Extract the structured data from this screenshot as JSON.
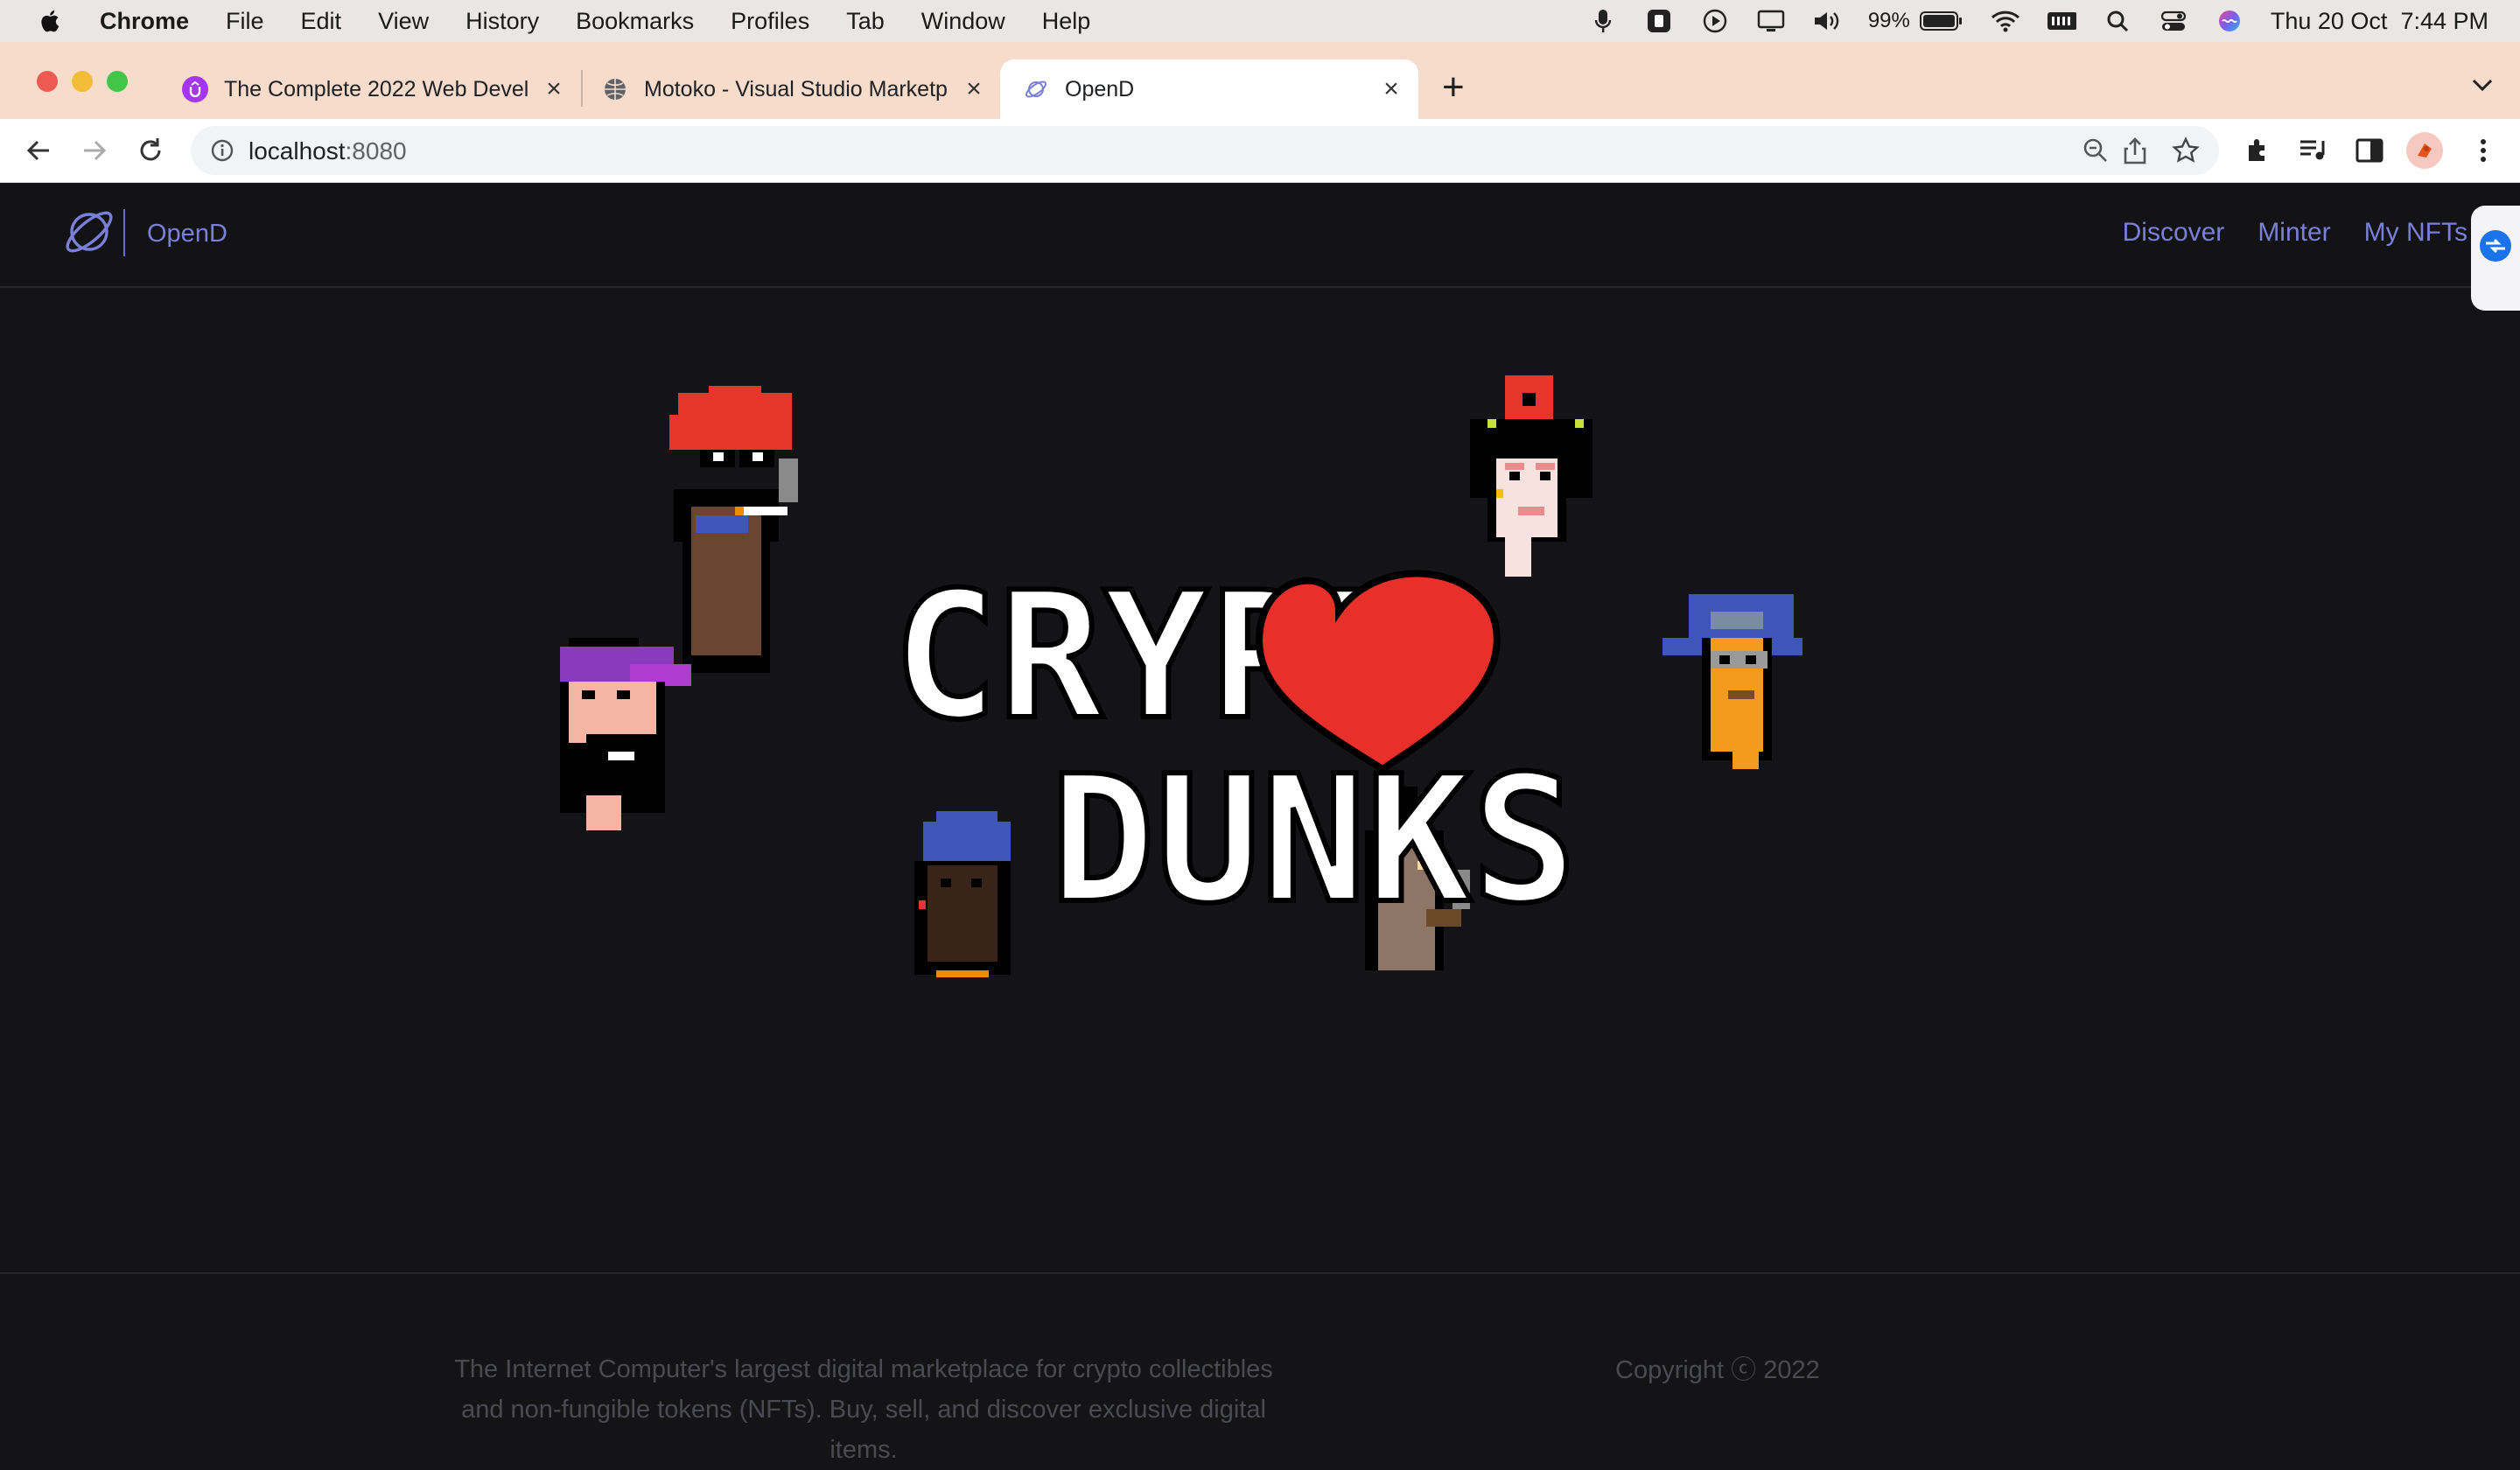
{
  "menubar": {
    "app": "Chrome",
    "items": [
      "File",
      "Edit",
      "View",
      "History",
      "Bookmarks",
      "Profiles",
      "Tab",
      "Window",
      "Help"
    ],
    "battery": "99%",
    "datetime": "Thu 20 Oct  7:44 PM"
  },
  "tabs": [
    {
      "title": "The Complete 2022 Web Devel",
      "icon": "udemy-icon"
    },
    {
      "title": "Motoko - Visual Studio Marketp",
      "icon": "globe-icon"
    },
    {
      "title": "OpenD",
      "icon": "opend-icon",
      "active": true
    }
  ],
  "address": {
    "host": "localhost",
    "port": ":8080"
  },
  "site": {
    "brand": "OpenD",
    "nav": [
      "Discover",
      "Minter",
      "My NFTs"
    ],
    "hero": {
      "line1": "CRYPT",
      "line2": "DUNKS"
    },
    "footer": {
      "description": "The Internet Computer's largest digital marketplace for crypto collectibles and non-fungible tokens (NFTs). Buy, sell, and discover exclusive digital items.",
      "copyright": "Copyright ⓒ 2022"
    }
  },
  "colors": {
    "nav": "#7a7fd8",
    "page_bg": "#141416",
    "heart": "#e8302a",
    "tabstrip": "#f8dccb"
  }
}
